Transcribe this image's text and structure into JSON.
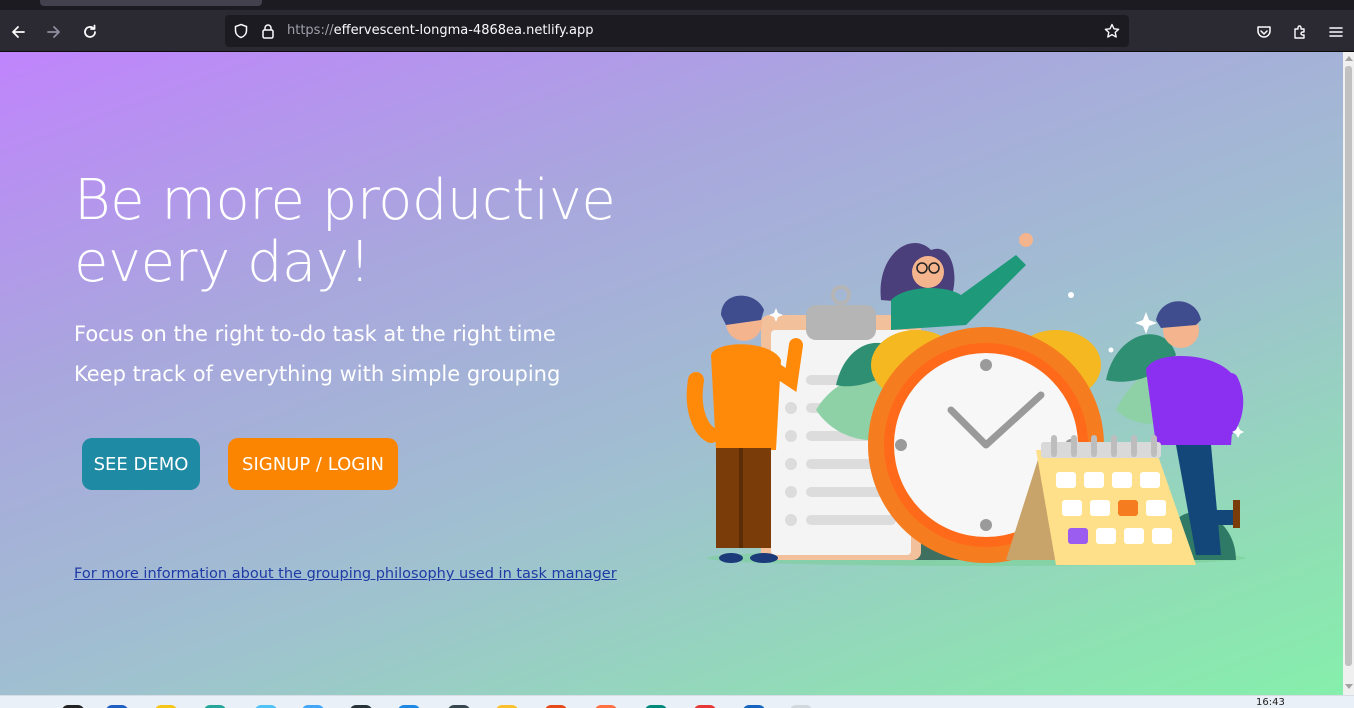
{
  "browser": {
    "url_scheme": "https://",
    "url_host": "effervescent-longma-4868ea.netlify.app"
  },
  "hero": {
    "title": "Be more productive every day!",
    "subtitle_1": "Focus on the right to-do task at the right time",
    "subtitle_2": "Keep track of everything with simple grouping",
    "demo_button": "SEE DEMO",
    "signup_button": "SIGNUP / LOGIN",
    "info_link": "For more information about the grouping philosophy used in task manager"
  },
  "taskbar": {
    "clock": "16:43"
  },
  "colors": {
    "gradient_start": "#c084fc",
    "gradient_end": "#86efac",
    "demo_button": "#1f8aa3",
    "signup_button": "#fb8500",
    "link": "#1f3aa6"
  },
  "icons": [
    "back-arrow-icon",
    "forward-arrow-icon",
    "reload-icon",
    "shield-icon",
    "lock-icon",
    "bookmark-star-icon",
    "pocket-icon",
    "extensions-icon",
    "menu-icon"
  ]
}
